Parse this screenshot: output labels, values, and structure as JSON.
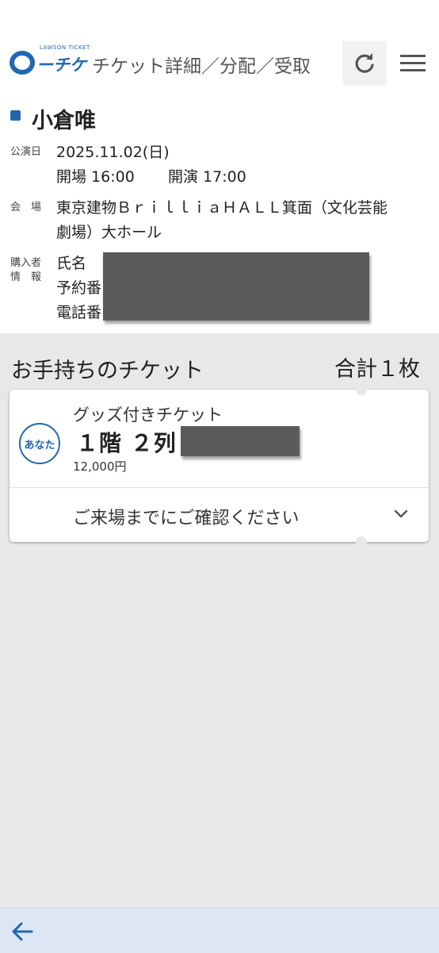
{
  "header": {
    "logo_caption": "LAWSON TICKET",
    "logo_text": "ーチケ",
    "title": "チケット詳細／分配／受取",
    "icons": {
      "reload": "reload-icon",
      "menu": "hamburger-menu-icon"
    }
  },
  "event": {
    "performer": "小倉唯",
    "date_label": "公演日",
    "date": "2025.11.02(日)",
    "open_time": "開場 16:00",
    "start_time": "開演 17:00",
    "venue_label": "会　場",
    "venue_line1": "東京建物ＢｒｉｌｌｉａＨＡＬＬ箕面（文化芸能",
    "venue_line2": "劇場）大ホール",
    "buyer_label_line1": "購入者",
    "buyer_label_line2": "情　報",
    "buyer_name_label": "氏名",
    "buyer_reservation_label": "予約番",
    "buyer_phone_label": "電話番"
  },
  "tickets": {
    "section_title": "お手持ちのチケット",
    "total": "合計１枚",
    "items": [
      {
        "owner": "あなた",
        "type": "グッズ付きチケット",
        "seat": "１階 ２列",
        "price": "12,000円",
        "confirm": "ご来場までにご確認ください"
      }
    ]
  },
  "colors": {
    "accent": "#1f67b3",
    "marker": "#2266aa",
    "background": "#e8e8e8",
    "bottom_bar": "#dde7f3"
  },
  "footer": {
    "back_icon": "arrow-left-icon"
  }
}
